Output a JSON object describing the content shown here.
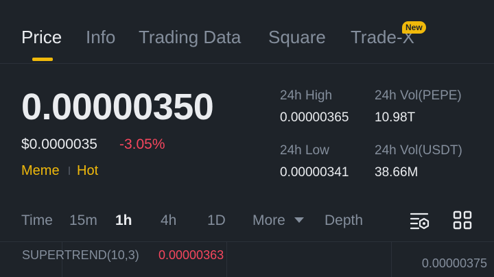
{
  "tabs": [
    {
      "label": "Price",
      "active": true
    },
    {
      "label": "Info"
    },
    {
      "label": "Trading Data"
    },
    {
      "label": "Square"
    },
    {
      "label": "Trade-X",
      "badge": "New"
    }
  ],
  "price": {
    "last": "0.00000350",
    "usd": "$0.0000035",
    "change": "-3.05%",
    "tags": [
      "Meme",
      "Hot"
    ]
  },
  "stats": {
    "high_label": "24h High",
    "high_value": "0.00000365",
    "vol_base_label": "24h Vol(PEPE)",
    "vol_base_value": "10.98T",
    "low_label": "24h Low",
    "low_value": "0.00000341",
    "vol_quote_label": "24h Vol(USDT)",
    "vol_quote_value": "38.66M"
  },
  "intervals": {
    "items": [
      "Time",
      "15m",
      "1h",
      "4h",
      "1D",
      "More",
      "Depth"
    ],
    "active": "1h"
  },
  "chart": {
    "indicator_label": "SUPERTREND(10,3)",
    "indicator_value": "0.00000363",
    "axis_top": "0.00000375"
  },
  "colors": {
    "accent": "#f0b90b",
    "down": "#f6465d",
    "muted": "#848e9c",
    "bg": "#1e2329"
  },
  "icons": [
    "chart-settings-icon",
    "grid-layout-icon",
    "chevron-down-icon"
  ]
}
